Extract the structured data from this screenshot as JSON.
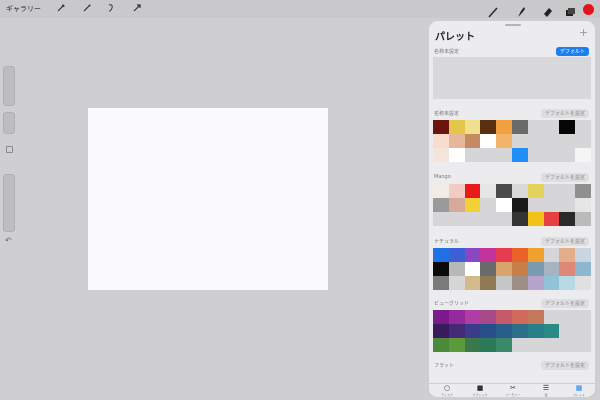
{
  "topbar": {
    "gallery_label": "ギャラリー",
    "left_tools": [
      "wrench-icon",
      "magic-wand-icon",
      "selection-icon",
      "transform-icon"
    ],
    "right_tools": [
      "brush-icon",
      "smudge-icon",
      "eraser-icon",
      "layers-icon"
    ],
    "current_color": "#e0141b"
  },
  "palette": {
    "title": "パレット",
    "sections": [
      {
        "label": "名称未設定",
        "button": "デフォルト",
        "active": true,
        "swatches": []
      },
      {
        "label": "名称未設定",
        "button": "デフォルトを設定",
        "active": false,
        "swatches": [
          "#6b1410",
          "#e4c64a",
          "#efe090",
          "#5a2f10",
          "#f0a040",
          "#6a6a6a",
          "",
          "",
          "#050505",
          "",
          "#f7ddd0",
          "#e6b89a",
          "#c48a62",
          "#ffffff",
          "#f3b46a",
          "",
          "",
          "",
          "",
          "",
          "#f5e4dc",
          "#ffffff",
          "",
          "",
          "",
          "#1f8ff5",
          "",
          "",
          "",
          "#f5f5f5"
        ]
      },
      {
        "label": "Mango",
        "button": "デフォルトを設定",
        "active": false,
        "swatches": [
          "#f4ebe6",
          "#f0ccc4",
          "#e81a1a",
          "#e6e6e6",
          "#4a4a4a",
          "#d9d9d9",
          "#e3d35c",
          "",
          "",
          "#8f8f8f",
          "#9a9a9a",
          "#d6a999",
          "#f0d238",
          "",
          "#ffffff",
          "#1a1a1a",
          "",
          "",
          "",
          "#e6e6e6",
          "",
          "",
          "",
          "",
          "",
          "#343434",
          "#f2c21a",
          "#e64040",
          "#2a2a2a",
          "#bbbbbb"
        ]
      },
      {
        "label": "ナチュラル",
        "button": "デフォルトを設定",
        "active": false,
        "swatches": [
          "#1e72e6",
          "#3d5fd6",
          "#8a47c2",
          "#c2349c",
          "#e63c52",
          "#e8622a",
          "#f0a02c",
          "",
          "#e6ad8a",
          "#c9d5e0",
          "#0a0a0a",
          "#b8b8b8",
          "#ffffff",
          "#6a6a6a",
          "#d9a46c",
          "#c77f4a",
          "#7a9ab0",
          "#a6b4bf",
          "#e08878",
          "#8db6cf",
          "#7a7a7a",
          "",
          "#d3b98c",
          "#8f7a56",
          "#c6c6c6",
          "#9d8f86",
          "#b6a4cc",
          "#8fc3d8",
          "#b8d9e6",
          "#e0e0e0"
        ]
      },
      {
        "label": "ビューグリッド",
        "button": "デフォルトを設定",
        "active": false,
        "swatches": [
          "#7b1a8a",
          "#962a9c",
          "#b03ca6",
          "#a84a8a",
          "#c45a6a",
          "#d06a5a",
          "#c47a5a",
          "",
          "",
          "",
          "#3a1a5c",
          "#452a78",
          "#3a3c8a",
          "#2a4e8a",
          "#2a5e8a",
          "#2a6e8a",
          "#2a7e8a",
          "#2a8a86",
          "",
          "",
          "#4a8a3a",
          "#5a9a3a",
          "#3a7a4a",
          "#2a7a5a",
          "#3a8a6a",
          "",
          "",
          "",
          "",
          ""
        ]
      },
      {
        "label": "フラット",
        "button": "デフォルトを設定",
        "active": false,
        "swatches": []
      }
    ],
    "tabs": [
      {
        "icon": "circle-icon",
        "label": "ディスク",
        "active": false
      },
      {
        "icon": "square-icon",
        "label": "クラシック",
        "active": false
      },
      {
        "icon": "harmony-icon",
        "label": "ハーモニー",
        "active": false
      },
      {
        "icon": "sliders-icon",
        "label": "値",
        "active": false
      },
      {
        "icon": "grid-icon",
        "label": "パレット",
        "active": true
      }
    ]
  }
}
